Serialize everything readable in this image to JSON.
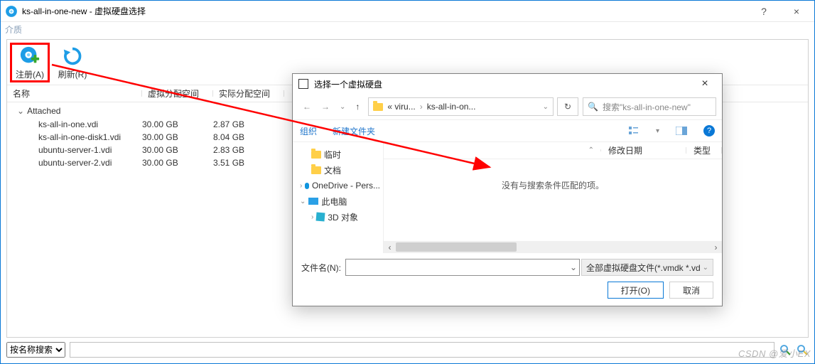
{
  "window": {
    "title": "ks-all-in-one-new - 虚拟硬盘选择",
    "help": "?",
    "close": "×"
  },
  "menubar": {
    "item0": "介质"
  },
  "toolbar": {
    "register": "注册(A)",
    "refresh": "刷新(R)"
  },
  "table": {
    "headers": {
      "name": "名称",
      "vsize": "虚拟分配空间",
      "asize": "实际分配空间"
    },
    "group": "Attached",
    "rows": [
      {
        "name": "ks-all-in-one.vdi",
        "vsize": "30.00 GB",
        "asize": "2.87 GB"
      },
      {
        "name": "ks-all-in-one-disk1.vdi",
        "vsize": "30.00 GB",
        "asize": "8.04 GB"
      },
      {
        "name": "ubuntu-server-1.vdi",
        "vsize": "30.00 GB",
        "asize": "2.83 GB"
      },
      {
        "name": "ubuntu-server-2.vdi",
        "vsize": "30.00 GB",
        "asize": "3.51 GB"
      }
    ]
  },
  "bottom": {
    "search_mode": "按名称搜索",
    "search_value": ""
  },
  "file_dialog": {
    "title": "选择一个虚拟硬盘",
    "breadcrumb": {
      "seg1": "« viru...",
      "seg2": "ks-all-in-on..."
    },
    "search_placeholder": "搜索\"ks-all-in-one-new\"",
    "organize": "组织",
    "new_folder": "新建文件夹",
    "tree": {
      "temp": "临时",
      "docs": "文档",
      "onedrive": "OneDrive - Pers...",
      "thispc": "此电脑",
      "obj3d": "3D 对象"
    },
    "list_headers": {
      "date": "修改日期",
      "type": "类型"
    },
    "empty_msg": "没有与搜索条件匹配的项。",
    "filename_label": "文件名(N):",
    "filename_value": "",
    "type_filter": "全部虚拟硬盘文件(*.vmdk *.vd",
    "open_btn": "打开(O)",
    "cancel_btn": "取消"
  },
  "watermark": "CSDN @爱小EX"
}
